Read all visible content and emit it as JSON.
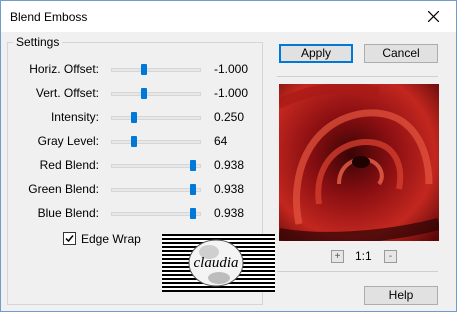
{
  "window": {
    "title": "Blend Emboss"
  },
  "settings": {
    "group_label": "Settings",
    "rows": [
      {
        "label": "Horiz. Offset:",
        "value": "-1.000",
        "level": 0.37
      },
      {
        "label": "Vert. Offset:",
        "value": "-1.000",
        "level": 0.37
      },
      {
        "label": "Intensity:",
        "value": "0.250",
        "level": 0.25
      },
      {
        "label": "Gray Level:",
        "value": "64",
        "level": 0.25
      },
      {
        "label": "Red Blend:",
        "value": "0.938",
        "level": 0.91
      },
      {
        "label": "Green Blend:",
        "value": "0.938",
        "level": 0.91
      },
      {
        "label": "Blue Blend:",
        "value": "0.938",
        "level": 0.91
      }
    ],
    "edge_wrap": {
      "label": "Edge Wrap",
      "checked": true
    }
  },
  "buttons": {
    "apply": "Apply",
    "cancel": "Cancel",
    "help": "Help"
  },
  "preview": {
    "zoom_in": "+",
    "zoom_level": "1:1",
    "zoom_out": "-"
  },
  "watermark": {
    "text": "claudia"
  },
  "colors": {
    "accent": "#0078d7",
    "rose": "#8b0f12"
  }
}
